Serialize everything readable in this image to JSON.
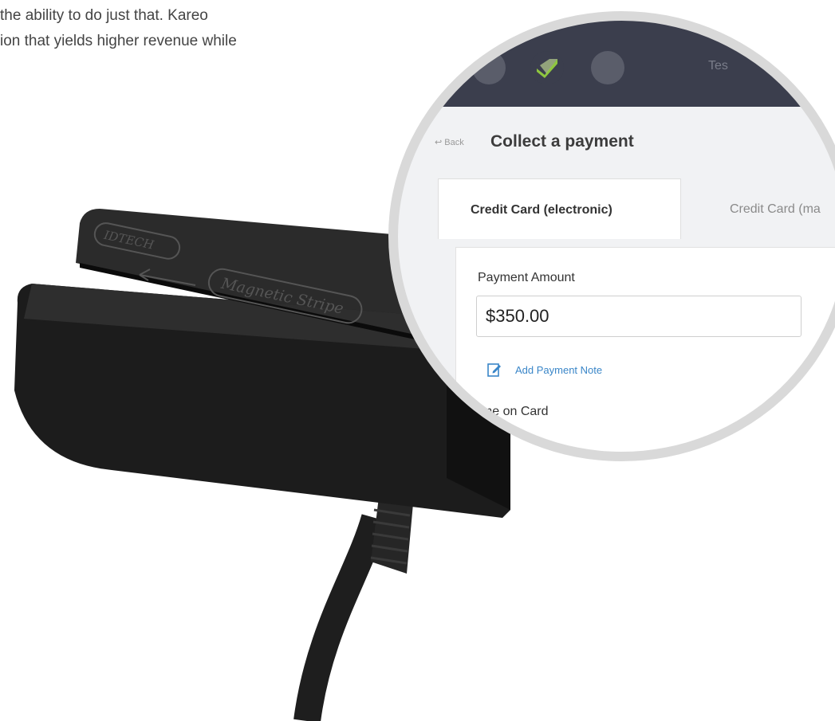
{
  "intro": {
    "line1": "the ability to do just that. Kareo",
    "line2": "ion that yields higher revenue while"
  },
  "device": {
    "brand": "IDTECH",
    "label": "Magnetic Stripe"
  },
  "app": {
    "user_fragment": "Tes",
    "back_label": "Back",
    "page_title": "Collect a payment",
    "tabs": [
      {
        "label": "Credit Card (electronic)",
        "active": true
      },
      {
        "label": "Credit Card (ma",
        "active": false
      }
    ],
    "form": {
      "payment_amount_label": "Payment Amount",
      "payment_amount_value": "$350.00",
      "add_note_label": "Add Payment Note",
      "name_on_card_label": "ame on Card"
    }
  },
  "colors": {
    "topbar": "#3b3e4d",
    "accent_green": "#8ec63f",
    "link_blue": "#3a86c8",
    "ring": "#d9d9d9"
  }
}
